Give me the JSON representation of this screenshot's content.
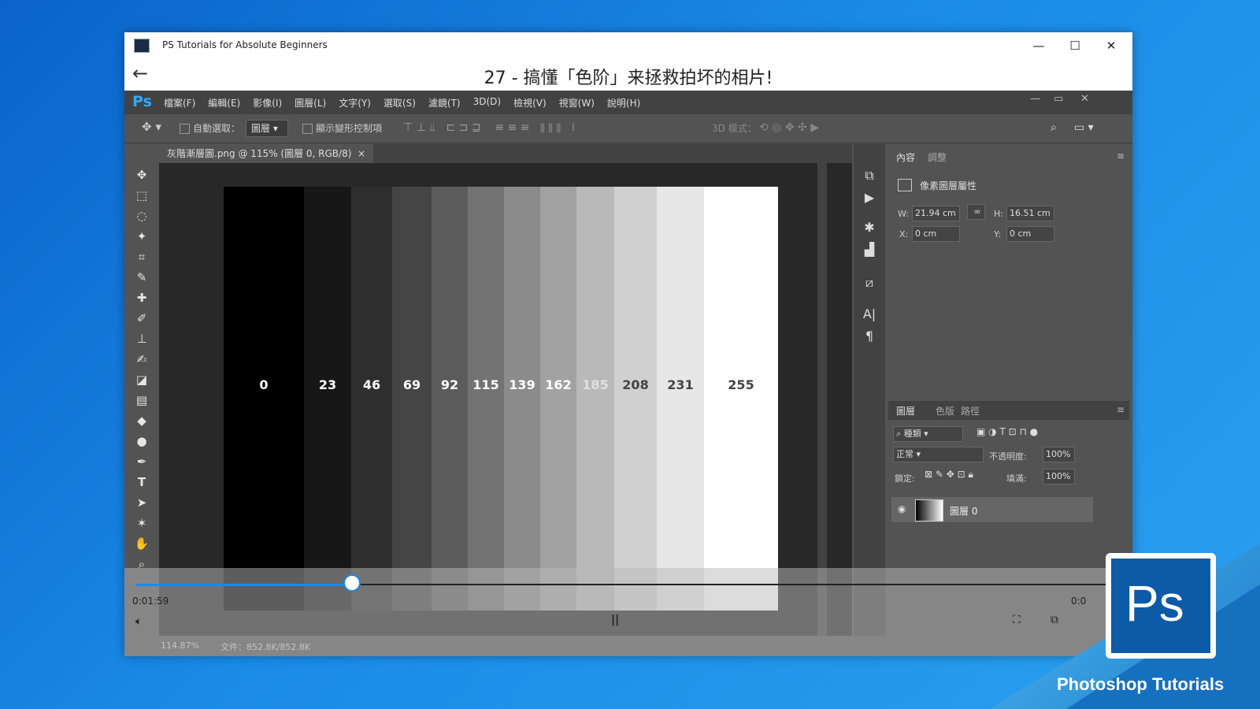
{
  "window": {
    "app_title": "PS Tutorials for Absolute Beginners",
    "lesson_title": "27 - 搞懂「色阶」来拯救拍坏的相片!",
    "controls": {
      "minimize": "—",
      "maximize": "☐",
      "close": "✕"
    },
    "back_icon": "←"
  },
  "photoshop": {
    "logo": "Ps",
    "menu": [
      "檔案(F)",
      "編輯(E)",
      "影像(I)",
      "圖層(L)",
      "文字(Y)",
      "選取(S)",
      "濾鏡(T)",
      "3D(D)",
      "檢視(V)",
      "視窗(W)",
      "說明(H)"
    ],
    "options": {
      "auto_select": "自動選取：",
      "auto_select_target": "圖層",
      "show_transform": "顯示變形控制項",
      "mode_3d": "3D 模式："
    },
    "document_tab": "灰階漸層圖.png @ 115% (圖層 0, RGB/8)",
    "tab_close": "×",
    "gray_values": [
      "0",
      "23",
      "46",
      "69",
      "92",
      "115",
      "139",
      "162",
      "185",
      "208",
      "231",
      "255"
    ],
    "gray_colors": [
      "#000000",
      "#171717",
      "#2e2e2e",
      "#454545",
      "#5c5c5c",
      "#737373",
      "#8b8b8b",
      "#a2a2a2",
      "#b9b9b9",
      "#d0d0d0",
      "#e7e7e7",
      "#ffffff"
    ],
    "properties": {
      "tab_active": "內容",
      "tab_other": "調整",
      "header": "像素圖層屬性",
      "w_label": "W:",
      "w_value": "21.94 cm",
      "h_label": "H:",
      "h_value": "16.51 cm",
      "x_label": "X:",
      "x_value": "0 cm",
      "y_label": "Y:",
      "y_value": "0 cm"
    },
    "layers": {
      "tabs": [
        "圖層",
        "色版",
        "路徑"
      ],
      "kind": "種類",
      "blend": "正常",
      "opacity_label": "不透明度:",
      "opacity": "100%",
      "lock_label": "鎖定:",
      "fill_label": "填滿:",
      "fill": "100%",
      "layer_name": "圖層 0"
    },
    "status": {
      "zoom": "114.87%",
      "doc": "文件：852.8K/852.8K"
    }
  },
  "player": {
    "current_time": "0:01:59",
    "end_time": "0:0",
    "progress": 0.22,
    "pause_icon": "||",
    "volume_icon": "volume-icon"
  },
  "badge": {
    "logo": "Ps",
    "text": "Photoshop Tutorials"
  }
}
